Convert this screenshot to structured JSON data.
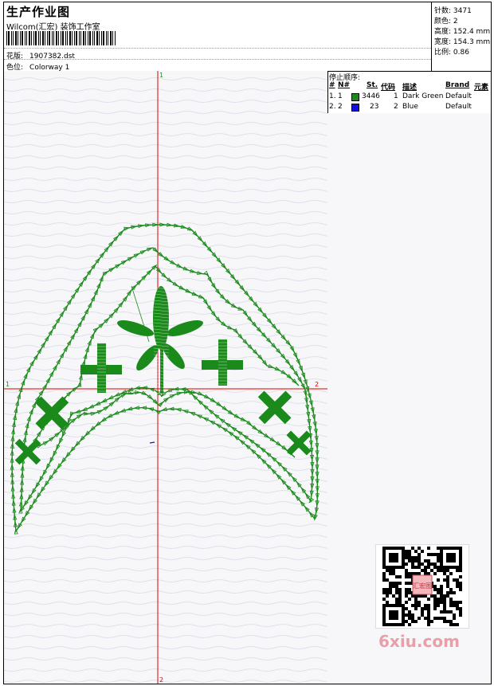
{
  "header": {
    "title": "生产作业图",
    "company": "Wilcom(汇宏) 装饰工作室",
    "design_label": "花版:",
    "design_file": "1907382.dst",
    "colorway_label": "色位:",
    "colorway": "Colorway 1"
  },
  "specs": [
    {
      "label": "针数:",
      "value": "3471"
    },
    {
      "label": "颜色:",
      "value": "2"
    },
    {
      "label": "高度:",
      "value": "152.4 mm"
    },
    {
      "label": "宽度:",
      "value": "154.3 mm"
    },
    {
      "label": "比例:",
      "value": "0.86"
    }
  ],
  "axis_labels": {
    "top": "1",
    "left": "1",
    "right": "2",
    "bottom": "2"
  },
  "stops": {
    "title": "停止顺序:",
    "headers": {
      "num": "#",
      "n": "N#",
      "st": "St.",
      "code": "代码",
      "desc": "描述",
      "brand": "Brand",
      "elem": "元素"
    },
    "rows": [
      {
        "num": "1.",
        "n": "1",
        "color": "#1a8a1a",
        "st": "3446",
        "code": "1",
        "desc": "Dark Green",
        "brand": "Default"
      },
      {
        "num": "2.",
        "n": "2",
        "color": "#1010e0",
        "st": "23",
        "code": "2",
        "desc": "Blue",
        "brand": "Default"
      }
    ]
  },
  "watermark": {
    "site": "6xiu.com",
    "stamp": "汇宏图"
  },
  "colors": {
    "thread_green": "#1a8a1a",
    "thread_blue": "#1010e0",
    "axis_red": "#dd0000"
  }
}
